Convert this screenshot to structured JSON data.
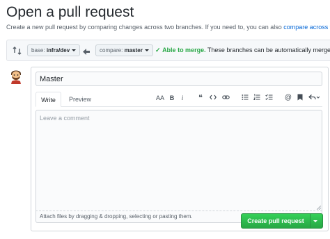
{
  "page": {
    "title": "Open a pull request",
    "subtitle": "Create a new pull request by comparing changes across two branches. If you need to, you can also ",
    "subtitle_link": "compare across forks."
  },
  "compare_bar": {
    "base_key": "base:",
    "base_value": "infra/dev",
    "compare_key": "compare:",
    "compare_value": "master",
    "merge_check": "✓",
    "merge_ok": "Able to merge.",
    "merge_text": "These branches can be automatically merged."
  },
  "form": {
    "title_value": "Master",
    "tabs": [
      {
        "label": "Write"
      },
      {
        "label": "Preview"
      }
    ],
    "toolbar": {
      "heading": "AA",
      "bold": "B",
      "italic": "i",
      "quote": "❝"
    },
    "comment_placeholder": "Leave a comment",
    "attach_text": "Attach files by dragging & dropping, selecting or pasting them."
  },
  "actions": {
    "create_label": "Create pull request"
  },
  "colors": {
    "accent": "#0366d6",
    "success": "#28a745",
    "button_green": "#2ea44f"
  },
  "icons": {
    "swap": "git-compare-icon",
    "arrow": "arrow-left-icon",
    "avatar": "user-avatar",
    "markdown": "markdown-icon"
  }
}
